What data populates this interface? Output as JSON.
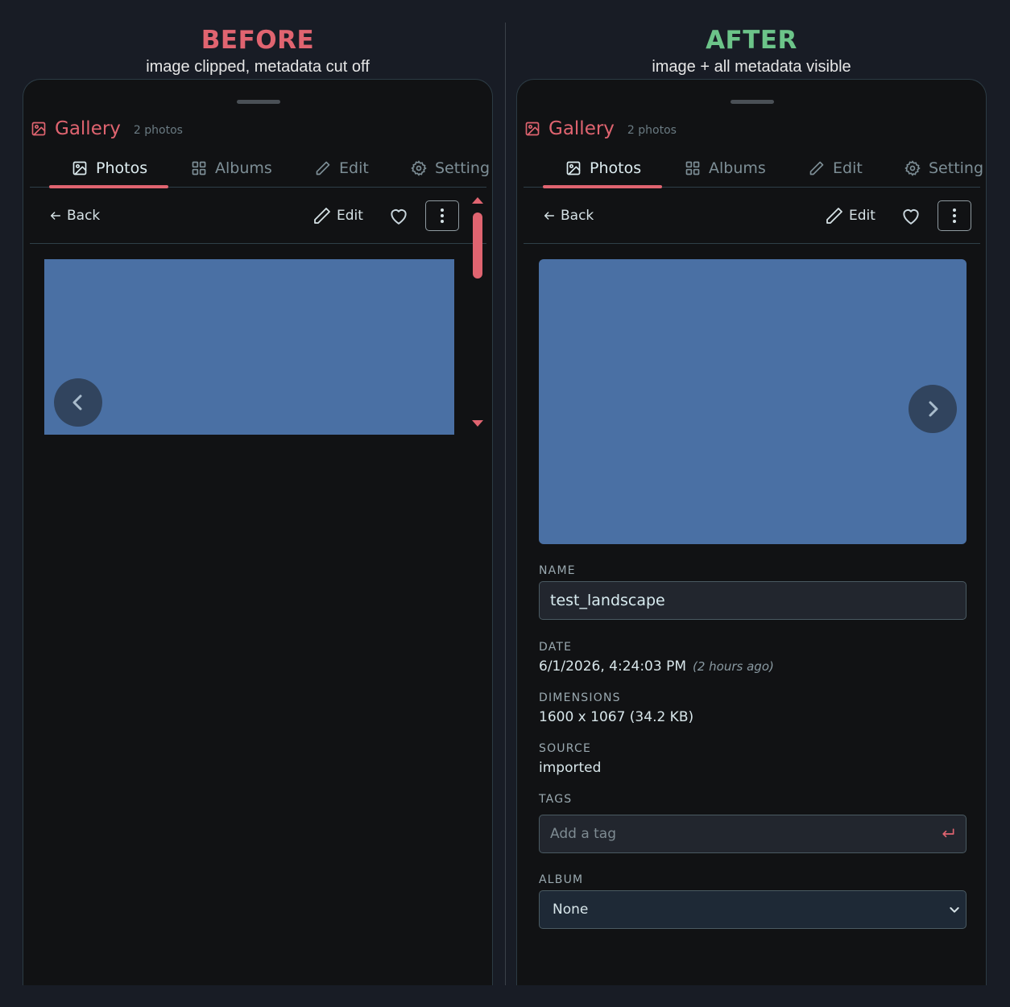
{
  "before": {
    "heading": "BEFORE",
    "subheading": "image clipped, metadata cut off"
  },
  "after": {
    "heading": "AFTER",
    "subheading": "image + all metadata visible"
  },
  "gallery": {
    "title": "Gallery",
    "count": "2 photos"
  },
  "tabs": [
    {
      "label": "Photos",
      "icon": "image-icon",
      "active": true
    },
    {
      "label": "Albums",
      "icon": "grid-icon",
      "active": false
    },
    {
      "label": "Edit",
      "icon": "pencil-icon",
      "active": false
    },
    {
      "label": "Setting",
      "icon": "gear-icon",
      "active": false
    }
  ],
  "toolbar": {
    "back_label": "Back",
    "edit_label": "Edit"
  },
  "metadata": {
    "name_label": "NAME",
    "name_value": "test_landscape",
    "date_label": "DATE",
    "date_value": "6/1/2026, 4:24:03 PM",
    "date_relative": "(2 hours ago)",
    "dimensions_label": "DIMENSIONS",
    "dimensions_value": "1600 x 1067 (34.2 KB)",
    "source_label": "SOURCE",
    "source_value": "imported",
    "tags_label": "TAGS",
    "tags_placeholder": "Add a tag",
    "album_label": "ALBUM",
    "album_value": "None"
  },
  "colors": {
    "accent": "#e06470",
    "after_heading": "#6cc489",
    "photo": "#4a70a4",
    "panel_bg": "#111214"
  }
}
